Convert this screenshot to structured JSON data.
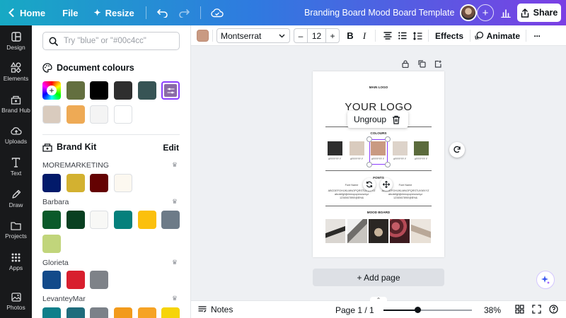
{
  "topbar": {
    "home_label": "Home",
    "file_label": "File",
    "resize_label": "Resize",
    "title": "Branding Board Mood Board Template",
    "share_label": "Share",
    "gradient_colors": [
      "#17a9c4",
      "#2f7ae0",
      "#7b3fe4"
    ]
  },
  "rail": {
    "items": [
      {
        "label": "Design",
        "icon": "layout-icon"
      },
      {
        "label": "Elements",
        "icon": "shapes-icon"
      },
      {
        "label": "Brand Hub",
        "icon": "brand-hub-icon"
      },
      {
        "label": "Uploads",
        "icon": "cloud-upload-icon"
      },
      {
        "label": "Text",
        "icon": "text-icon"
      },
      {
        "label": "Draw",
        "icon": "pen-icon"
      },
      {
        "label": "Projects",
        "icon": "folder-icon"
      },
      {
        "label": "Apps",
        "icon": "grid-icon"
      },
      {
        "label": "Photos",
        "icon": "image-icon"
      }
    ]
  },
  "panel": {
    "search_placeholder": "Try \"blue\" or \"#00c4cc\"",
    "document_colours": {
      "title": "Document colours",
      "colors": [
        "#636f3f",
        "#000000",
        "#2e2e2e",
        "#375455",
        "#d9cbbe",
        "#eeaa55",
        "#f4f4f4",
        "#ffffff"
      ]
    },
    "brand_kit": {
      "title": "Brand Kit",
      "edit_label": "Edit",
      "palettes": [
        {
          "name": "MOREMARKETING",
          "colors": [
            "#021a6a",
            "#d3b130",
            "#640202",
            "#fcf8f0"
          ]
        },
        {
          "name": "Barbara",
          "colors": [
            "#0a5a2a",
            "#094021",
            "#f8f8f6",
            "#06807c",
            "#fbc00d",
            "#6d7b88",
            "#c1d57b"
          ]
        },
        {
          "name": "Glorieta",
          "colors": [
            "#124a8a",
            "#d81f2e",
            "#7e8288"
          ]
        },
        {
          "name": "LevanteyMar",
          "colors": [
            "#0e7f8a",
            "#1f6c7c",
            "#7b8189",
            "#f29a1c",
            "#f6a325",
            "#f6d408"
          ]
        }
      ]
    }
  },
  "toolbar": {
    "text_color": "#c99a82",
    "font_name": "Montserrat",
    "font_size": "12",
    "minus": "–",
    "plus": "+",
    "effects_label": "Effects",
    "animate_label": "Animate",
    "more": "···"
  },
  "page": {
    "main_logo": "MAIN LOGO",
    "your_logo": "YOUR LOGO",
    "colours_heading": "COLOURS",
    "fonts_heading": "FONTS",
    "mood_board_heading": "MOOD BOARD",
    "swatches": [
      {
        "color": "#2e2e2e",
        "label": "#FFFFFF F"
      },
      {
        "color": "#d9cbbe",
        "label": "#FFFFFF F"
      },
      {
        "color": "#c99a82",
        "label": "#FFFFFF F"
      },
      {
        "color": "#ddd3ca",
        "label": "#FFFFFF F"
      },
      {
        "color": "#5b6b3c",
        "label": "#FFFFFF F"
      }
    ],
    "font_left": {
      "name": "Font Name",
      "alpha_upper": "ABCDEFGHIJKLMNOPQRSTUVWXYZ",
      "alpha_lower": "abcdefghijklmnopqrstuvwxyz",
      "digits": "1234567890!@$%&"
    },
    "font_right": {
      "name": "Font Name",
      "alpha_upper": "ABCDEFGHIJKLMNOPQRSTUVWXYZ",
      "alpha_lower": "abcdefghijklmnopqrstuvwxyz",
      "digits": "1234567890!@$%&"
    },
    "photos": [
      "#d6d0c9",
      "#9a9894",
      "#3e3a36",
      "#7d3b40",
      "#d5c9bd"
    ]
  },
  "context": {
    "ungroup_label": "Ungroup",
    "add_page_label": "+ Add page"
  },
  "bottombar": {
    "notes_label": "Notes",
    "page_indicator": "Page 1 / 1",
    "zoom_label": "38%",
    "zoom_value": 0.38
  }
}
